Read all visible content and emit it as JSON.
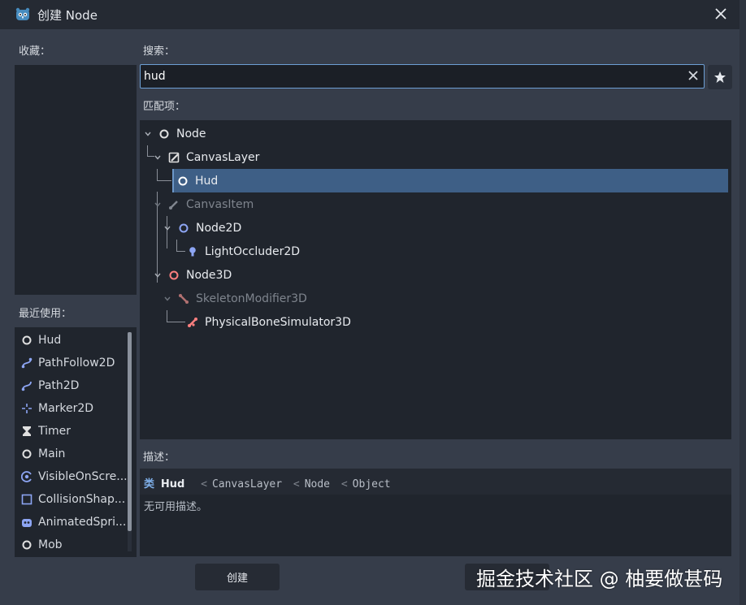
{
  "window": {
    "title": "创建 Node"
  },
  "labels": {
    "favorites": "收藏：",
    "search": "搜索：",
    "matches": "匹配项：",
    "recent": "最近使用：",
    "description": "描述："
  },
  "search": {
    "value": "hud"
  },
  "tree": {
    "node": "Node",
    "canvas_layer": "CanvasLayer",
    "hud": "Hud",
    "canvas_item": "CanvasItem",
    "node2d": "Node2D",
    "light_occluder": "LightOccluder2D",
    "node3d": "Node3D",
    "skeleton_modifier": "SkeletonModifier3D",
    "physical_bone": "PhysicalBoneSimulator3D"
  },
  "recent": [
    {
      "label": "Hud",
      "icon": "circle-icon"
    },
    {
      "label": "PathFollow2D",
      "icon": "path-follow-icon"
    },
    {
      "label": "Path2D",
      "icon": "path-icon"
    },
    {
      "label": "Marker2D",
      "icon": "marker-icon"
    },
    {
      "label": "Timer",
      "icon": "hourglass-icon"
    },
    {
      "label": "Main",
      "icon": "circle-icon"
    },
    {
      "label": "VisibleOnScre...",
      "icon": "visible-icon"
    },
    {
      "label": "CollisionShap...",
      "icon": "collision-shape-icon"
    },
    {
      "label": "AnimatedSpri...",
      "icon": "animated-sprite-icon"
    },
    {
      "label": "Mob",
      "icon": "circle-icon"
    }
  ],
  "description": {
    "class_word": "类",
    "class_name": "Hud",
    "sep": "<",
    "chain": [
      "CanvasLayer",
      "Node",
      "Object"
    ],
    "body": "无可用描述。"
  },
  "buttons": {
    "create": "创建"
  },
  "watermark": "掘金技术社区 @ 柚要做甚码",
  "colors": {
    "accent": "#6d9fd4",
    "selection": "#3e5f86",
    "node2d_blue": "#8da5f3",
    "node3d_red": "#fc7f7f",
    "node_white": "#e0e0e0"
  }
}
